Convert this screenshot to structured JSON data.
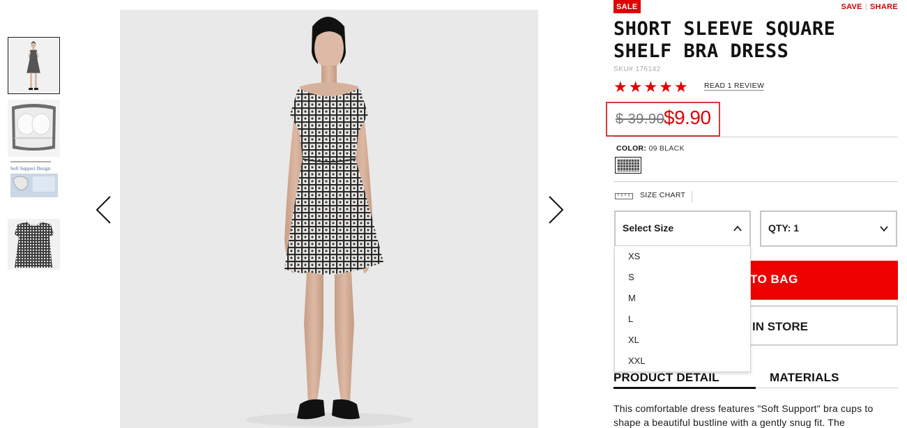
{
  "gallery": {
    "thumbnails": [
      "dress-front-thumbnail",
      "bra-cup-detail-thumbnail",
      "soft-support-design-thumbnail",
      "dress-flat-thumbnail"
    ],
    "thumbnail_text": "Soft Support Design",
    "active_index": 0
  },
  "product": {
    "badge": "SALE",
    "actions": {
      "save": "SAVE",
      "share": "SHARE"
    },
    "title": "SHORT SLEEVE SQUARE SHELF BRA DRESS",
    "sku": "SKU# 176142",
    "rating": {
      "stars": 5,
      "review_link": "READ 1 REVIEW"
    },
    "price": {
      "original": "$ 39.90",
      "sale": "$9.90"
    },
    "color": {
      "label": "COLOR:",
      "value": "09 BLACK"
    },
    "size_chart": "SIZE CHART",
    "size_select": {
      "value": "Select Size",
      "options": [
        "XS",
        "S",
        "M",
        "L",
        "XL",
        "XXL"
      ]
    },
    "qty_select": {
      "value": "QTY: 1"
    },
    "add_to_bag_visible": "TO BAG",
    "find_in_store_visible": "IN STORE",
    "tabs": [
      "PRODUCT DETAIL",
      "MATERIALS"
    ],
    "description": "This comfortable dress features \"Soft Support\" bra cups to shape a beautiful bustline with a gently snug fit. The"
  },
  "colors": {
    "accent": "#e00000",
    "price_box_border": "#d43a3a",
    "text": "#1b1b1b"
  },
  "icons": {
    "prev": "chevron-left-icon",
    "next": "chevron-right-icon",
    "size_chart": "ruler-icon",
    "select": "chevron-up-icon",
    "qty": "chevron-down-icon"
  }
}
